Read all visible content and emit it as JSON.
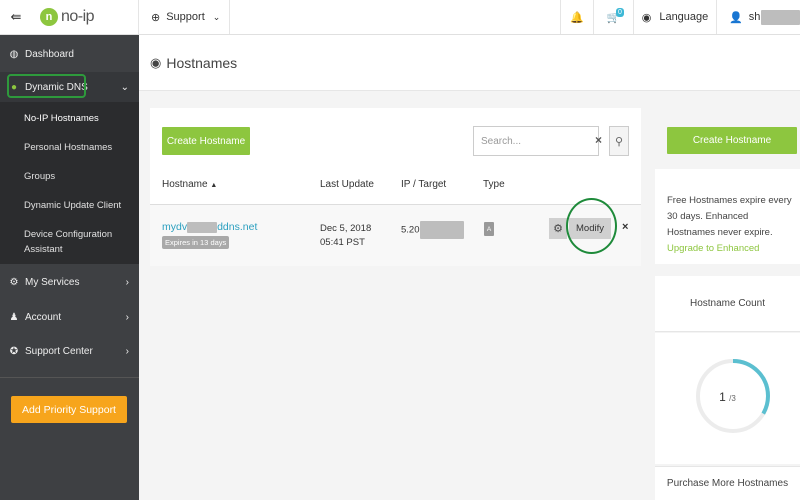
{
  "topbar": {
    "logo_text": "no-ip",
    "support_label": "Support",
    "cart_count": "0",
    "language_label": "Language",
    "user_initials": "sh"
  },
  "sidebar": {
    "dashboard": "Dashboard",
    "dynamic_dns": "Dynamic DNS",
    "sub_items": [
      "No-IP Hostnames",
      "Personal Hostnames",
      "Groups",
      "Dynamic Update Client",
      "Device Configuration Assistant"
    ],
    "my_services": "My Services",
    "account": "Account",
    "support_center": "Support Center",
    "priority_button": "Add Priority Support"
  },
  "page": {
    "title": "Hostnames"
  },
  "toolbar": {
    "create_label": "Create Hostname",
    "search_placeholder": "Search..."
  },
  "table": {
    "headers": [
      "Hostname",
      "Last Update",
      "IP / Target",
      "Type"
    ],
    "sort_indicator": "▲",
    "rows": [
      {
        "hostname_prefix": "mydv",
        "hostname_suffix": "ddns.net",
        "expires": "Expires in 13 days",
        "last_update_date": "Dec 5, 2018",
        "last_update_time": "05:41 PST",
        "ip_prefix": "5.20",
        "type": "A",
        "modify_label": "Modify"
      }
    ]
  },
  "right": {
    "create_label": "Create Hostname",
    "info_text": "Free Hostnames expire every 30 days. Enhanced Hostnames never expire.",
    "info_link": "Upgrade to Enhanced",
    "count_title": "Hostname Count",
    "count_used": "1",
    "count_total": "/3",
    "count_fraction": 0.3333,
    "purchase_label": "Purchase More Hostnames"
  },
  "colors": {
    "accent_green": "#8dc63f",
    "sidebar_bg": "#3e4043",
    "link_blue": "#2a9fbf",
    "priority_orange": "#f7a51c",
    "gauge_teal": "#5bbfd0",
    "annotation_green": "#1e8a3a"
  }
}
